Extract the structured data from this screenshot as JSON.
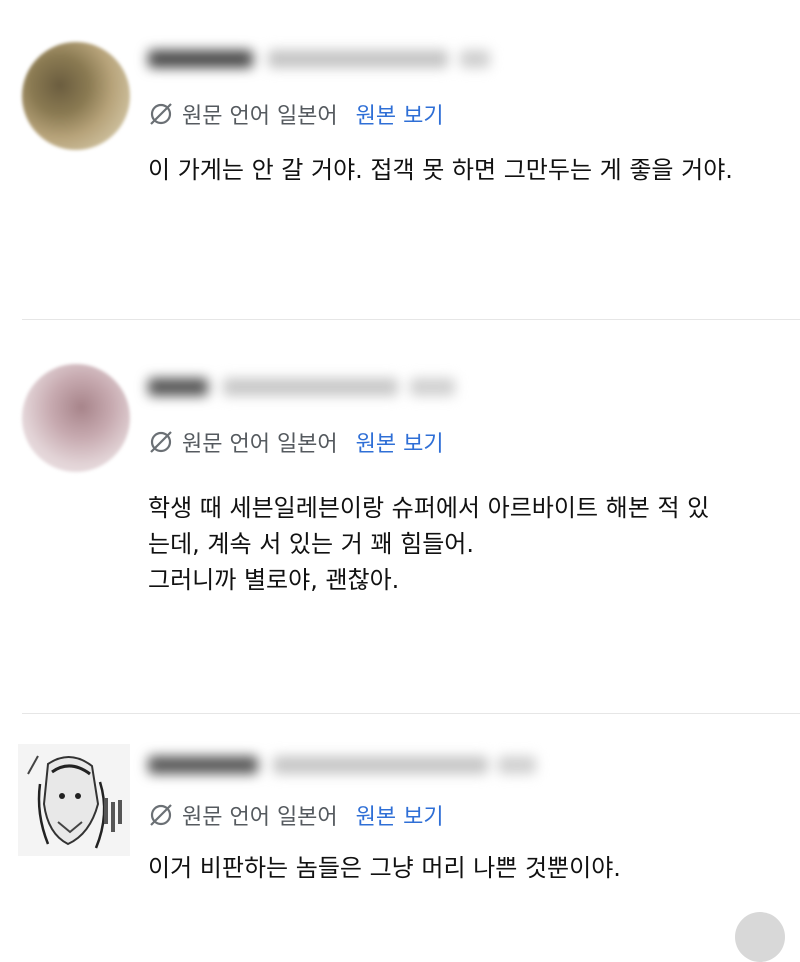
{
  "comments": [
    {
      "language_label": "원문 언어 일본어",
      "view_original": "원본 보기",
      "lines": [
        "이 가게는 안 갈 거야. 접객 못 하면 그만두는 게 좋을 거야."
      ]
    },
    {
      "language_label": "원문 언어 일본어",
      "view_original": "원본 보기",
      "lines": [
        "학생 때 세븐일레븐이랑 슈퍼에서 아르바이트 해본 적 있",
        "는데, 계속 서 있는 거 꽤 힘들어.",
        "그러니까 별로야, 괜찮아."
      ]
    },
    {
      "language_label": "원문 언어 일본어",
      "view_original": "원본 보기",
      "lines": [
        "이거 비판하는 놈들은 그냥 머리 나쁜 것뿐이야."
      ]
    }
  ],
  "icons": {
    "translate": "translate-slash-icon"
  },
  "colors": {
    "link": "#2f6fd6",
    "secondary_text": "#555a5f",
    "divider": "#e6e6e6"
  }
}
